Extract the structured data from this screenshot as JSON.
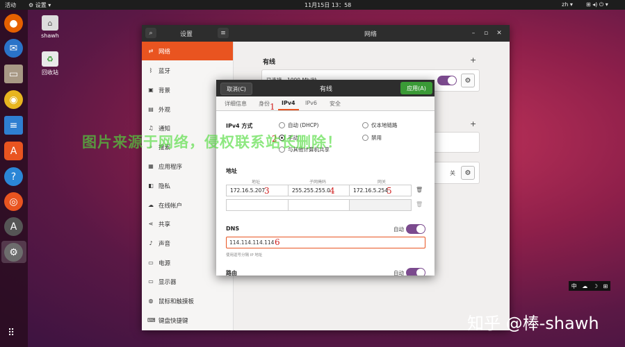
{
  "topbar": {
    "activities": "活动",
    "app_menu": "⚙ 设置 ▾",
    "clock": "11月15日  13：58",
    "lang": "zh ▾",
    "status_icons": "⊞ ◂) ⏻ ▾"
  },
  "desktop": {
    "icons": [
      {
        "label": "shawh",
        "icon": "home-folder-icon"
      },
      {
        "label": "回收站",
        "icon": "trash-icon"
      }
    ]
  },
  "settings": {
    "title": "设置",
    "panel_title": "网络",
    "sidebar": [
      {
        "label": "网络",
        "icon": "network-icon",
        "active": true
      },
      {
        "label": "蓝牙",
        "icon": "bluetooth-icon"
      },
      {
        "label": "背景",
        "icon": "background-icon"
      },
      {
        "label": "外观",
        "icon": "appearance-icon"
      },
      {
        "label": "通知",
        "icon": "bell-icon"
      },
      {
        "label": "搜索",
        "icon": "search-icon"
      },
      {
        "label": "应用程序",
        "icon": "apps-icon"
      },
      {
        "label": "隐私",
        "icon": "privacy-icon"
      },
      {
        "label": "在线帐户",
        "icon": "cloud-icon"
      },
      {
        "label": "共享",
        "icon": "share-icon"
      },
      {
        "label": "声音",
        "icon": "music-icon"
      },
      {
        "label": "电源",
        "icon": "power-icon"
      },
      {
        "label": "显示器",
        "icon": "display-icon"
      },
      {
        "label": "鼠标和触摸板",
        "icon": "mouse-icon"
      },
      {
        "label": "键盘快捷键",
        "icon": "keyboard-icon"
      }
    ],
    "wired_label": "有线",
    "wired_status": "已连接 - 1000 Mb/秒",
    "off_label": "关"
  },
  "dialog": {
    "cancel": "取消(C)",
    "title": "有线",
    "apply": "应用(A)",
    "tabs": [
      "详细信息",
      "身份",
      "IPv4",
      "IPv6",
      "安全"
    ],
    "ipv4_method_label": "IPv4 方式",
    "methods": {
      "auto": "自动 (DHCP)",
      "manual": "手动",
      "share": "与其他计算机共享",
      "link_local": "仅本地链路",
      "disable": "禁用"
    },
    "address_label": "地址",
    "columns": [
      "地址",
      "子网掩码",
      "网关"
    ],
    "address": "172.16.5.207",
    "netmask": "255.255.255.0",
    "gateway": "172.16.5.254",
    "dns_label": "DNS",
    "auto_label": "自动",
    "dns_value": "114.114.114.114",
    "dns_hint": "使用逗号分隔 IP 地址",
    "route_label": "路由"
  },
  "annotations": [
    "1",
    "2",
    "3",
    "4",
    "5",
    "6"
  ],
  "watermark": "图片来源于网络，侵权联系站长删除！",
  "zhihu_mark": "知乎 @棒-shawh",
  "colors": {
    "accent": "#e95420",
    "toggle": "#7b4a8e",
    "apply": "#3a9a36",
    "annotation": "#d02020"
  }
}
